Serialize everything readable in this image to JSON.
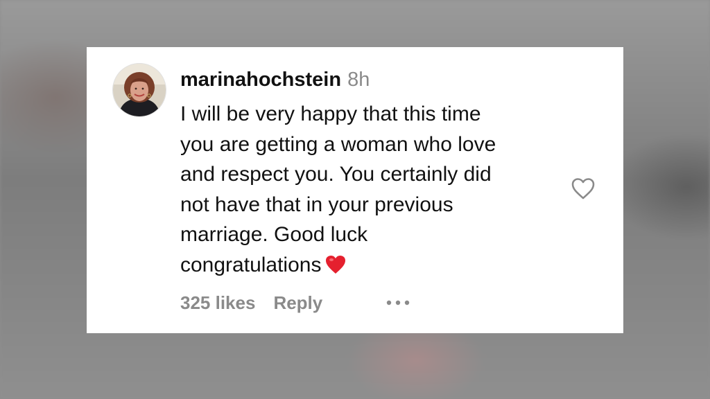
{
  "comment": {
    "username": "marinahochstein",
    "time": "8h",
    "lines": [
      "I will be very happy that this time",
      "you are getting a woman who love",
      "and respect you. You certainly did",
      "not have that in your previous",
      "marriage. Good luck",
      "congratulations"
    ],
    "emoji": "red-heart-emoji",
    "likes": "325 likes",
    "reply_label": "Reply",
    "like_icon": "heart-outline-icon",
    "more_icon": "ellipsis-icon"
  },
  "colors": {
    "card_background": "#ffffff",
    "text": "#111111",
    "muted": "#8a8a8a",
    "heart_red": "#e5202e",
    "backdrop": "#8e8e8e"
  }
}
